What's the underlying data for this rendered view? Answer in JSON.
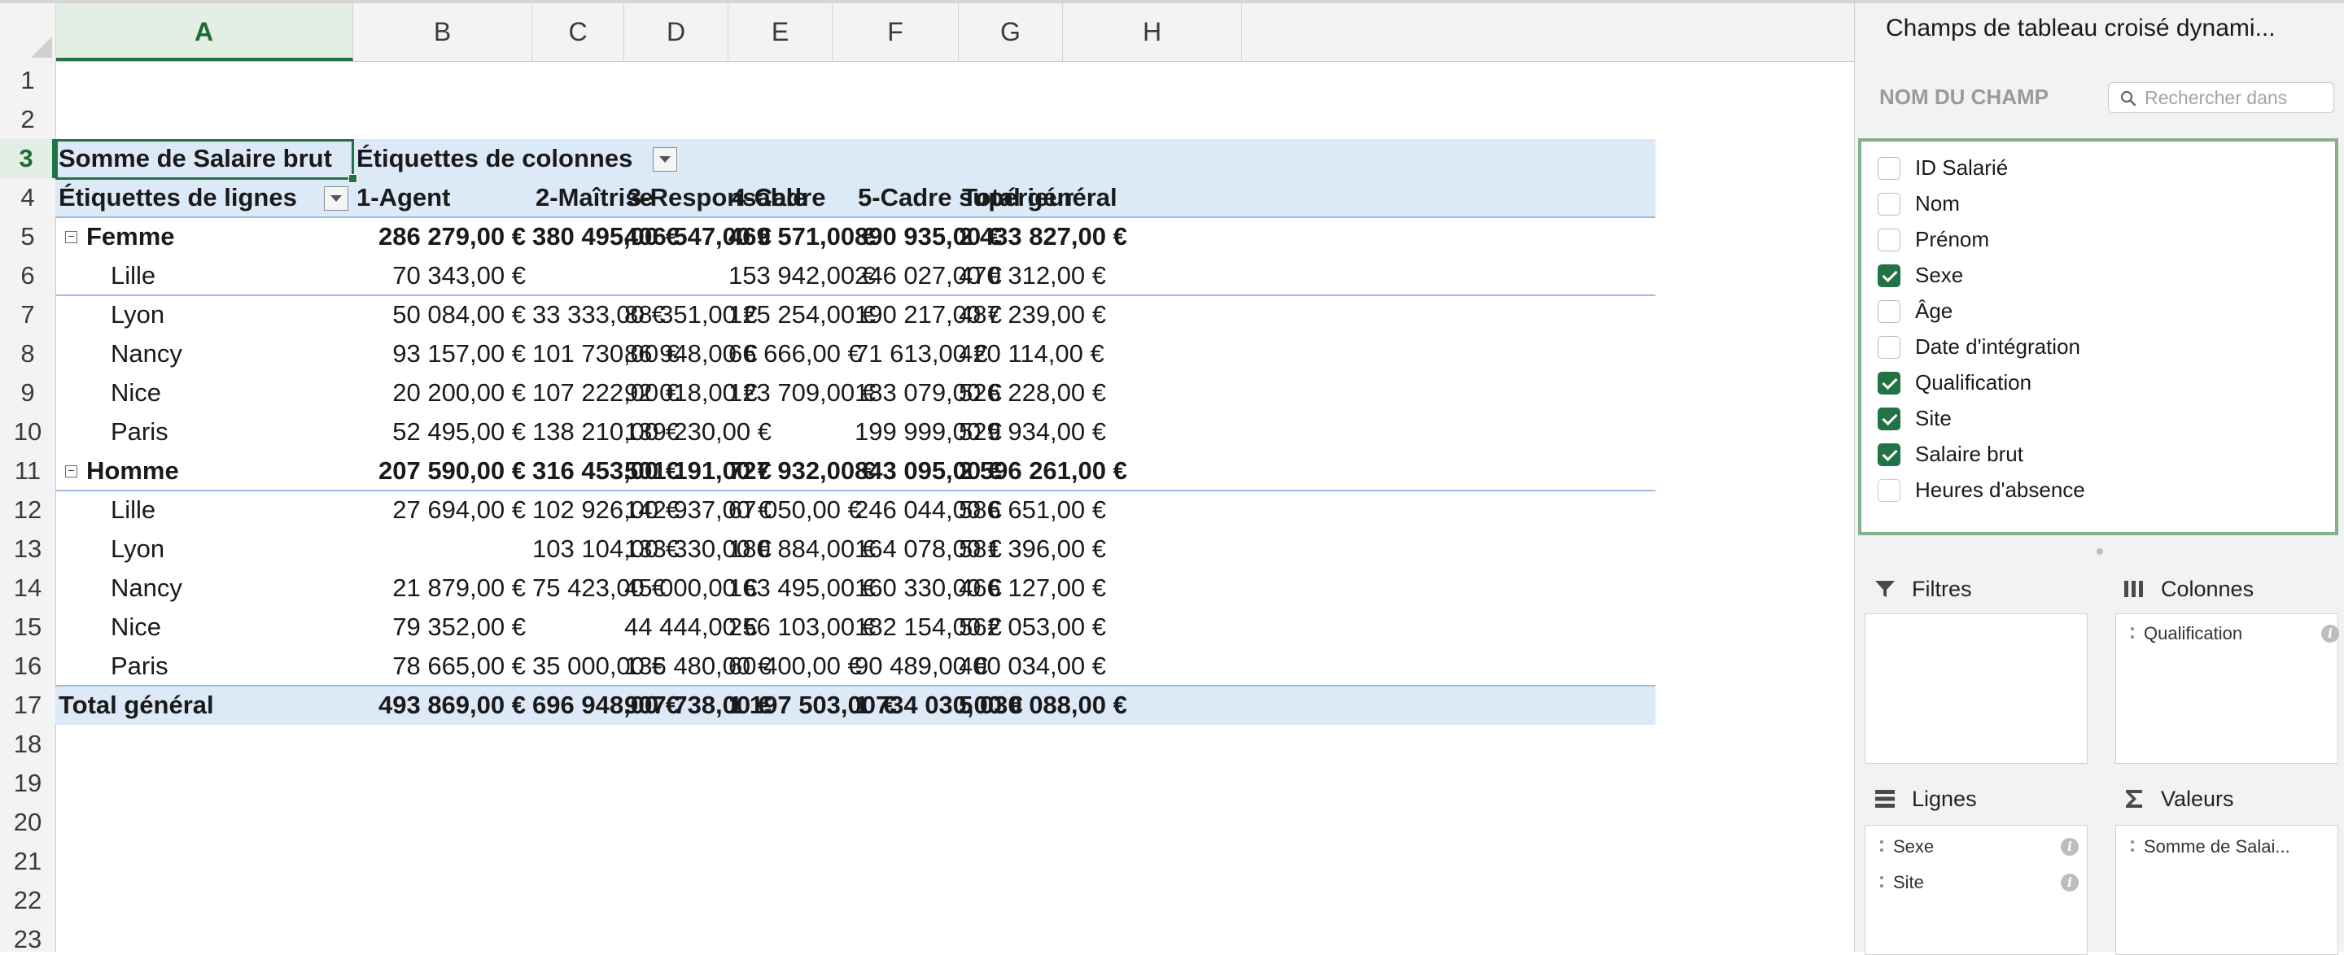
{
  "columns": [
    "A",
    "B",
    "C",
    "D",
    "E",
    "F",
    "G",
    "H"
  ],
  "rows": [
    "1",
    "2",
    "3",
    "4",
    "5",
    "6",
    "7",
    "8",
    "9",
    "10",
    "11",
    "12",
    "13",
    "14",
    "15",
    "16",
    "17",
    "18",
    "19",
    "20",
    "21",
    "22",
    "23"
  ],
  "pivot": {
    "value_label": "Somme de Salaire brut",
    "col_labels_title": "Étiquettes de colonnes",
    "row_labels_title": "Étiquettes de lignes",
    "col_headers": [
      "1-Agent",
      "2-Maîtrise",
      "3-Responsable",
      "4-Cadre",
      "5-Cadre supérieur",
      "Total général"
    ],
    "rows": [
      {
        "label": "Femme",
        "group": true,
        "values": [
          "286 279,00 €",
          "380 495,00 €",
          "406 547,00 €",
          "469 571,00 €",
          "890 935,00 €",
          "2 433 827,00 €"
        ]
      },
      {
        "label": "Lille",
        "values": [
          "70 343,00 €",
          "",
          "",
          "153 942,00 €",
          "246 027,00 €",
          "470 312,00 €"
        ]
      },
      {
        "label": "Lyon",
        "values": [
          "50 084,00 €",
          "33 333,00 €",
          "88 351,00 €",
          "125 254,00 €",
          "190 217,00 €",
          "487 239,00 €"
        ]
      },
      {
        "label": "Nancy",
        "values": [
          "93 157,00 €",
          "101 730,00 €",
          "86 948,00 €",
          "66 666,00 €",
          "71 613,00 €",
          "420 114,00 €"
        ]
      },
      {
        "label": "Nice",
        "values": [
          "20 200,00 €",
          "107 222,00 €",
          "92 018,00 €",
          "123 709,00 €",
          "183 079,00 €",
          "526 228,00 €"
        ]
      },
      {
        "label": "Paris",
        "values": [
          "52 495,00 €",
          "138 210,00 €",
          "139 230,00 €",
          "",
          "199 999,00 €",
          "529 934,00 €"
        ]
      },
      {
        "label": "Homme",
        "group": true,
        "values": [
          "207 590,00 €",
          "316 453,00 €",
          "501 191,00 €",
          "727 932,00 €",
          "843 095,00 €",
          "2 596 261,00 €"
        ]
      },
      {
        "label": "Lille",
        "values": [
          "27 694,00 €",
          "102 926,00 €",
          "142 937,00 €",
          "67 050,00 €",
          "246 044,00 €",
          "586 651,00 €"
        ]
      },
      {
        "label": "Lyon",
        "values": [
          "",
          "103 104,00 €",
          "133 330,00 €",
          "180 884,00 €",
          "164 078,00 €",
          "581 396,00 €"
        ]
      },
      {
        "label": "Nancy",
        "values": [
          "21 879,00 €",
          "75 423,00 €",
          "45 000,00 €",
          "163 495,00 €",
          "160 330,00 €",
          "466 127,00 €"
        ]
      },
      {
        "label": "Nice",
        "values": [
          "79 352,00 €",
          "",
          "44 444,00 €",
          "256 103,00 €",
          "182 154,00 €",
          "562 053,00 €"
        ]
      },
      {
        "label": "Paris",
        "values": [
          "78 665,00 €",
          "35 000,00 €",
          "135 480,00 €",
          "60 400,00 €",
          "90 489,00 €",
          "400 034,00 €"
        ]
      }
    ],
    "total": {
      "label": "Total général",
      "values": [
        "493 869,00 €",
        "696 948,00 €",
        "907 738,00 €",
        "1 197 503,00 €",
        "1 734 030,00 €",
        "5 030 088,00 €"
      ]
    }
  },
  "panel": {
    "title": "Champs de tableau croisé dynami...",
    "field_name_label": "NOM DU CHAMP",
    "search_placeholder": "Rechercher dans",
    "fields": [
      {
        "label": "ID Salarié",
        "checked": false
      },
      {
        "label": "Nom",
        "checked": false
      },
      {
        "label": "Prénom",
        "checked": false
      },
      {
        "label": "Sexe",
        "checked": true
      },
      {
        "label": "Âge",
        "checked": false
      },
      {
        "label": "Date d'intégration",
        "checked": false
      },
      {
        "label": "Qualification",
        "checked": true
      },
      {
        "label": "Site",
        "checked": true
      },
      {
        "label": "Salaire brut",
        "checked": true
      },
      {
        "label": "Heures d'absence",
        "checked": false
      }
    ],
    "zones": {
      "filters": {
        "title": "Filtres",
        "items": []
      },
      "columns": {
        "title": "Colonnes",
        "items": [
          "Qualification"
        ]
      },
      "rows": {
        "title": "Lignes",
        "items": [
          "Sexe",
          "Site"
        ]
      },
      "values": {
        "title": "Valeurs",
        "items": [
          "Somme de Salai..."
        ]
      }
    }
  },
  "colors": {
    "accent_green": "#217346",
    "pivot_band": "#dce9f7",
    "pivot_line": "#9fbedf",
    "field_list_border": "#86b08b"
  },
  "icons": [
    "corner-select-all-icon",
    "dropdown-arrow-icon",
    "collapse-minus-icon",
    "search-icon",
    "filter-icon",
    "columns-icon",
    "rows-icon",
    "sigma-icon",
    "drag-grip-icon",
    "info-icon"
  ]
}
